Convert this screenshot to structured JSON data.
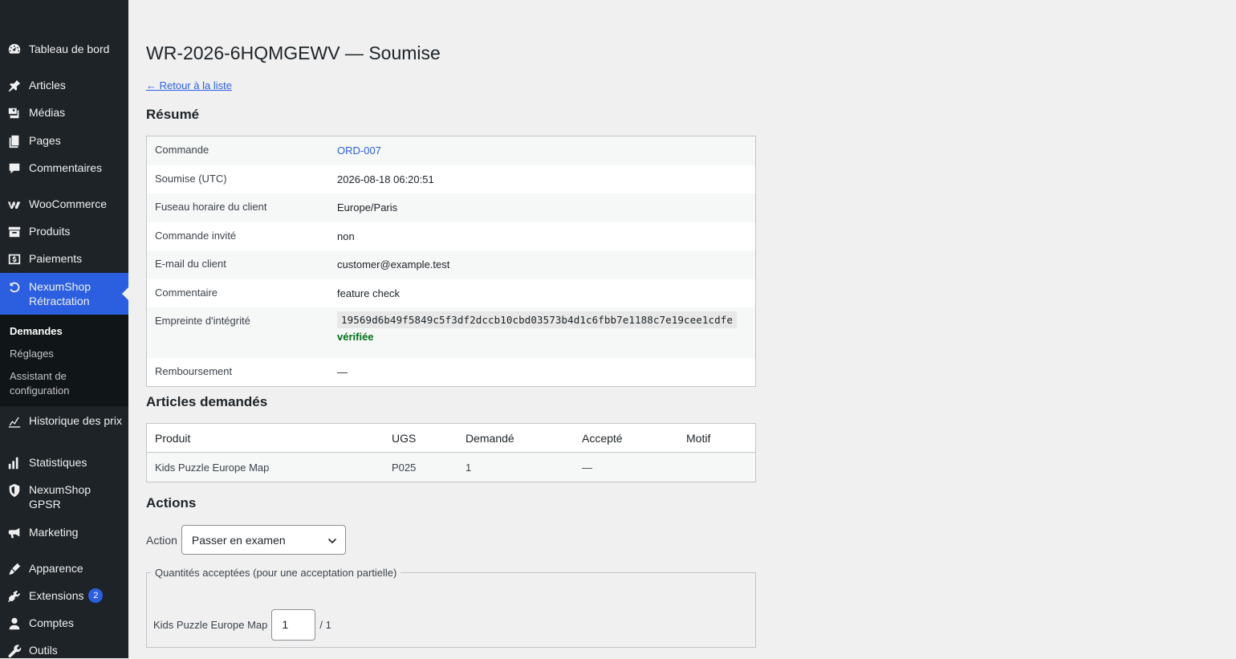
{
  "sidebar": {
    "items": [
      {
        "key": "dashboard",
        "label": "Tableau de bord",
        "icon": "dashboard-icon"
      },
      {
        "key": "posts",
        "label": "Articles",
        "icon": "pin-icon"
      },
      {
        "key": "media",
        "label": "Médias",
        "icon": "media-icon"
      },
      {
        "key": "pages",
        "label": "Pages",
        "icon": "pages-icon"
      },
      {
        "key": "comments",
        "label": "Commentaires",
        "icon": "comment-icon"
      },
      {
        "key": "woocommerce",
        "label": "WooCommerce",
        "icon": "woocommerce-icon"
      },
      {
        "key": "products",
        "label": "Produits",
        "icon": "archive-icon"
      },
      {
        "key": "payments",
        "label": "Paiements",
        "icon": "payments-icon"
      },
      {
        "key": "nexumshop_retractation",
        "label": "NexumShop Rétractation",
        "icon": "undo-icon"
      },
      {
        "key": "price_history",
        "label": "Historique des prix",
        "icon": "chart-line-icon"
      },
      {
        "key": "stats",
        "label": "Statistiques",
        "icon": "bar-chart-icon"
      },
      {
        "key": "gpsr",
        "label": "NexumShop GPSR",
        "icon": "shield-icon"
      },
      {
        "key": "marketing",
        "label": "Marketing",
        "icon": "megaphone-icon"
      },
      {
        "key": "appearance",
        "label": "Apparence",
        "icon": "brush-icon"
      },
      {
        "key": "plugins",
        "label": "Extensions",
        "icon": "plugin-icon",
        "badge": "2"
      },
      {
        "key": "users",
        "label": "Comptes",
        "icon": "user-icon"
      },
      {
        "key": "tools",
        "label": "Outils",
        "icon": "wrench-icon"
      }
    ],
    "submenu": [
      {
        "label": "Demandes",
        "current": true
      },
      {
        "label": "Réglages"
      },
      {
        "label": "Assistant de configuration"
      }
    ]
  },
  "page": {
    "title": "WR-2026-6HQMGEWV — Soumise",
    "back_link": "← Retour à la liste"
  },
  "summary": {
    "heading": "Résumé",
    "rows": {
      "order": {
        "label": "Commande",
        "value": "ORD-007"
      },
      "submitted": {
        "label": "Soumise (UTC)",
        "value": "2026-08-18 06:20:51"
      },
      "timezone": {
        "label": "Fuseau horaire du client",
        "value": "Europe/Paris"
      },
      "guest": {
        "label": "Commande invité",
        "value": "non"
      },
      "email": {
        "label": "E-mail du client",
        "value": "customer@example.test"
      },
      "comment": {
        "label": "Commentaire",
        "value": "feature check"
      },
      "integrity": {
        "label": "Empreinte d'intégrité",
        "value": "19569d6b49f5849c5f3df2dccb10cbd03573b4d1c6fbb7e1188c7e19cee1cdfe",
        "status": "vérifiée"
      },
      "refund": {
        "label": "Remboursement",
        "value": "—"
      }
    }
  },
  "items": {
    "heading": "Articles demandés",
    "columns": [
      "Produit",
      "UGS",
      "Demandé",
      "Accepté",
      "Motif"
    ],
    "rows": [
      {
        "product": "Kids Puzzle Europe Map",
        "sku": "P025",
        "requested": "1",
        "accepted": "—",
        "reason": ""
      }
    ]
  },
  "actions": {
    "heading": "Actions",
    "action_label": "Action",
    "action_selected": "Passer en examen",
    "qty_legend": "Quantités acceptées (pour une acceptation partielle)",
    "qty_rows": [
      {
        "product": "Kids Puzzle Europe Map",
        "value": "1",
        "max": "/ 1"
      }
    ]
  },
  "colors": {
    "accent": "#2c5fe0",
    "sidebar": "#1d2327",
    "verified": "#007017"
  }
}
